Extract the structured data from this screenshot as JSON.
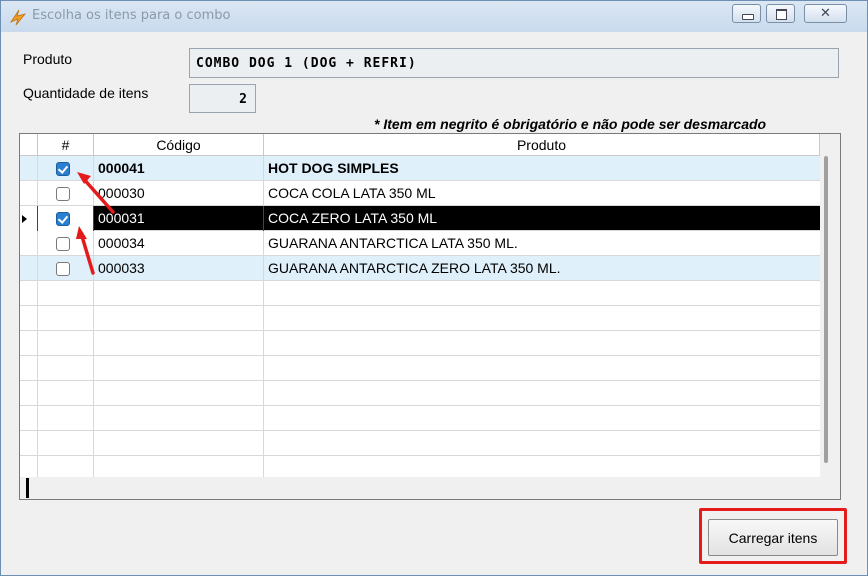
{
  "window": {
    "title": "Escolha os itens para o combo",
    "icon": "lightning-app-icon",
    "controls": [
      "minimize-icon",
      "maximize-icon",
      "close-icon"
    ]
  },
  "form": {
    "produto_label": "Produto",
    "produto_value": "COMBO DOG 1 (DOG + REFRI)",
    "quantidade_label": "Quantidade de itens",
    "quantidade_value": "2",
    "note": "* Item em negrito é obrigatório e não pode ser desmarcado"
  },
  "grid": {
    "headers": {
      "check": "#",
      "codigo": "Código",
      "produto": "Produto"
    },
    "rows": [
      {
        "checked": true,
        "codigo": "000041",
        "produto": "HOT DOG SIMPLES",
        "bold": true
      },
      {
        "checked": false,
        "codigo": "000030",
        "produto": "COCA COLA LATA 350 ML",
        "bold": false
      },
      {
        "checked": true,
        "codigo": "000031",
        "produto": "COCA ZERO LATA 350 ML",
        "bold": false,
        "selected": true
      },
      {
        "checked": false,
        "codigo": "000034",
        "produto": "GUARANA ANTARCTICA LATA 350 ML.",
        "bold": false
      },
      {
        "checked": false,
        "codigo": "000033",
        "produto": "GUARANA ANTARCTICA ZERO LATA 350 ML.",
        "bold": false
      }
    ]
  },
  "actions": {
    "load_label": "Carregar itens"
  },
  "colors": {
    "annotation": "#e41b1b",
    "selected_row": "#000000",
    "alt_row": "#dff0fb",
    "checkbox_on": "#2a7fd0"
  }
}
